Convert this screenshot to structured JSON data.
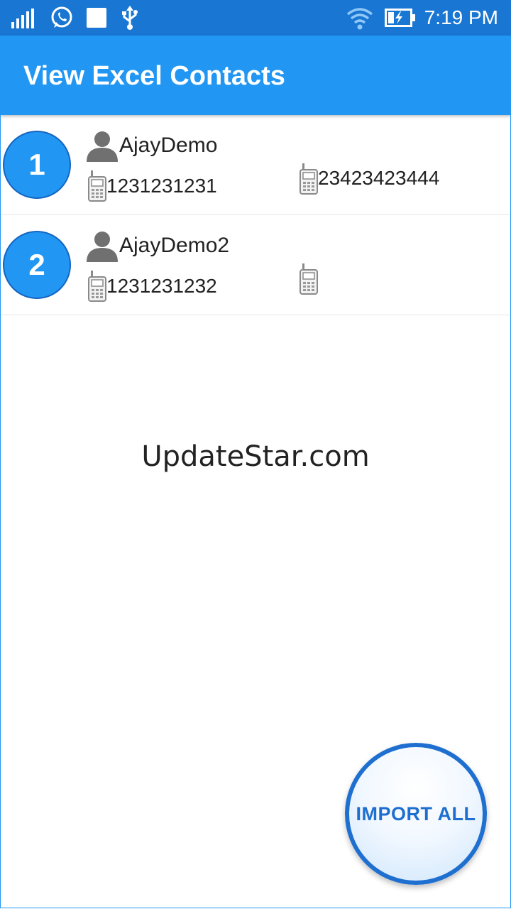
{
  "status_bar": {
    "time": "7:19 PM",
    "icons": [
      "signal-icon",
      "whatsapp-icon",
      "notification-square-icon",
      "usb-icon",
      "wifi-icon",
      "battery-charging-icon"
    ]
  },
  "app_bar": {
    "title": "View Excel Contacts"
  },
  "contacts": [
    {
      "index": "1",
      "name": "AjayDemo",
      "phone1": "1231231231",
      "phone2": "23423423444"
    },
    {
      "index": "2",
      "name": "AjayDemo2",
      "phone1": "1231231232",
      "phone2": ""
    }
  ],
  "watermark": "UpdateStar.com",
  "fab": {
    "label": "IMPORT ALL"
  },
  "colors": {
    "status_bar": "#1976d2",
    "app_bar": "#2196f3",
    "accent": "#1e6fd0"
  }
}
